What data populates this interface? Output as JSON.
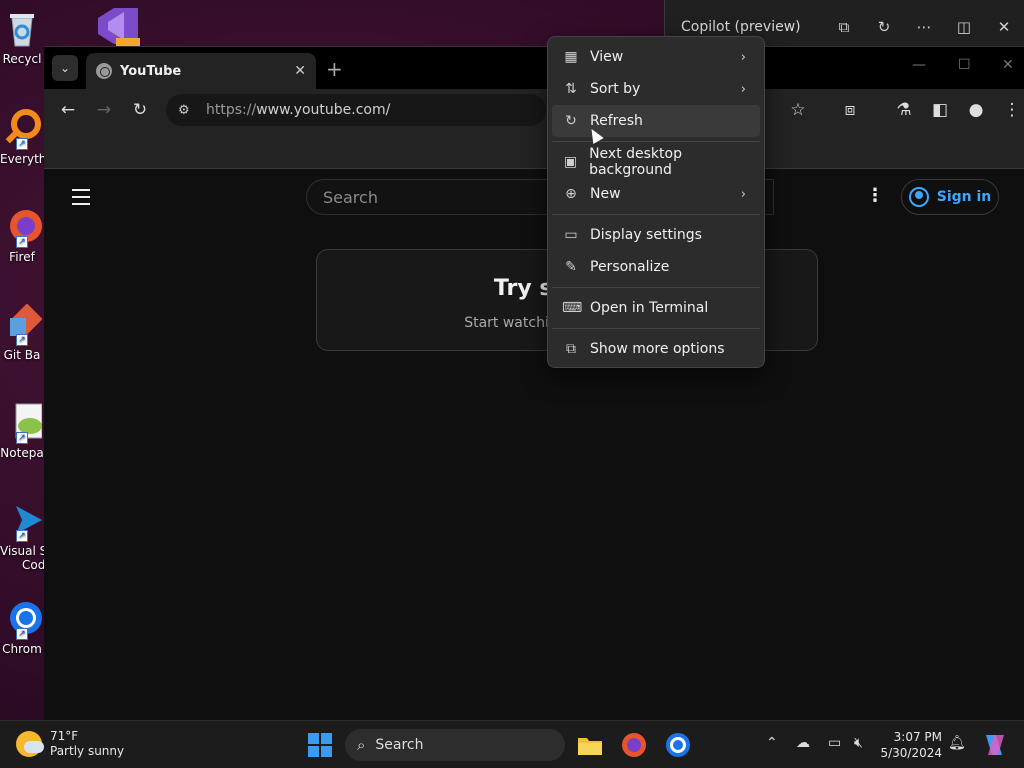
{
  "desktop": {
    "icons": [
      {
        "label": "Recycl"
      },
      {
        "label": "Everyth"
      },
      {
        "label": "Firef"
      },
      {
        "label": "Git Ba"
      },
      {
        "label": "Notepa"
      },
      {
        "label": "Visual S",
        "label2": "Cod"
      },
      {
        "label": "Chrom"
      }
    ]
  },
  "copilot": {
    "title": "Copilot (preview)"
  },
  "browser": {
    "tab": {
      "title": "YouTube",
      "close": "✕"
    },
    "new_tab": "+",
    "omnibox": {
      "url_prefix": "https://",
      "url_host": "www.youtube.com/"
    }
  },
  "youtube": {
    "search_placeholder": "Search",
    "sign_in": "Sign in",
    "card": {
      "title": "Try searchir",
      "subtitle": "Start watching videos to help"
    }
  },
  "context_menu": {
    "items": [
      {
        "label": "View",
        "icon": "grid-icon",
        "submenu": true
      },
      {
        "label": "Sort by",
        "icon": "sort-icon",
        "submenu": true
      },
      {
        "label": "Refresh",
        "icon": "refresh-icon",
        "submenu": false
      },
      {
        "label": "Next desktop background",
        "icon": "wallpaper-icon",
        "submenu": false
      },
      {
        "label": "New",
        "icon": "plus-circle-icon",
        "submenu": true
      },
      {
        "label": "Display settings",
        "icon": "display-icon",
        "submenu": false
      },
      {
        "label": "Personalize",
        "icon": "pen-icon",
        "submenu": false
      },
      {
        "label": "Open in Terminal",
        "icon": "terminal-icon",
        "submenu": false
      },
      {
        "label": "Show more options",
        "icon": "more-options-icon",
        "submenu": false
      }
    ]
  },
  "taskbar": {
    "weather": {
      "temp": "71°F",
      "desc": "Partly sunny"
    },
    "search_label": "Search",
    "clock": {
      "time": "3:07 PM",
      "date": "5/30/2024"
    }
  },
  "colors": {
    "accent": "#3ea6ff",
    "windows_blue": "#3a9bf0"
  }
}
